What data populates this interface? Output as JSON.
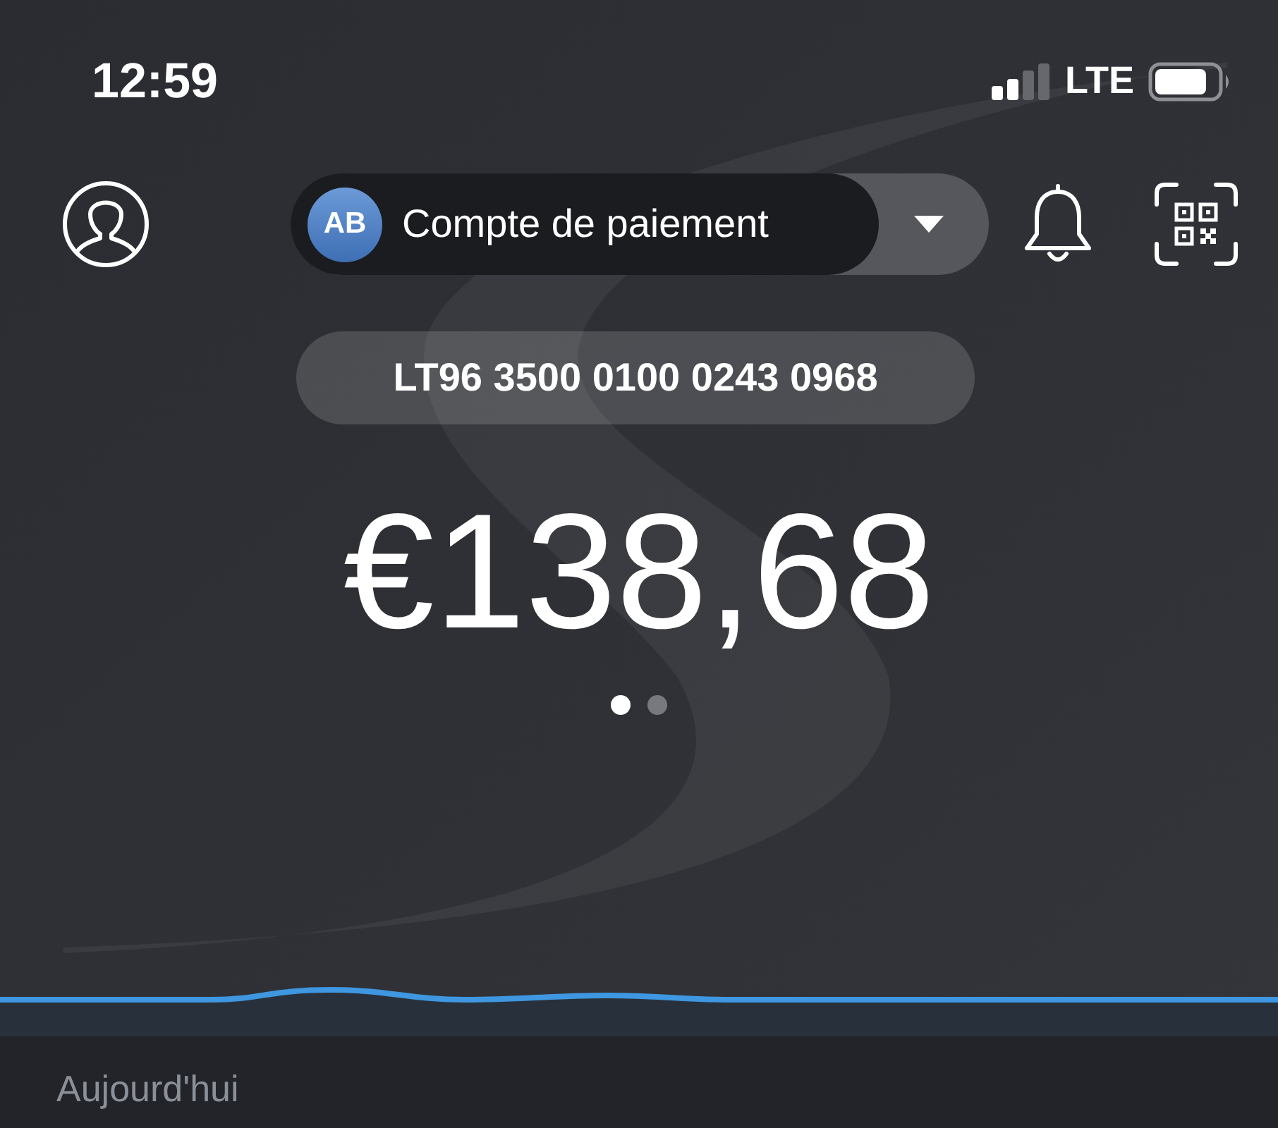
{
  "status_bar": {
    "time": "12:59",
    "network": "LTE"
  },
  "header": {
    "account_selector": {
      "avatar_initials": "AB",
      "name": "Compte de paiement"
    }
  },
  "account": {
    "iban": "LT96 3500 0100 0243 0968",
    "balance": "€138,68"
  },
  "pager": [
    {
      "selected": true
    },
    {
      "selected": false
    }
  ],
  "section": {
    "title": "Aujourd'hui"
  }
}
